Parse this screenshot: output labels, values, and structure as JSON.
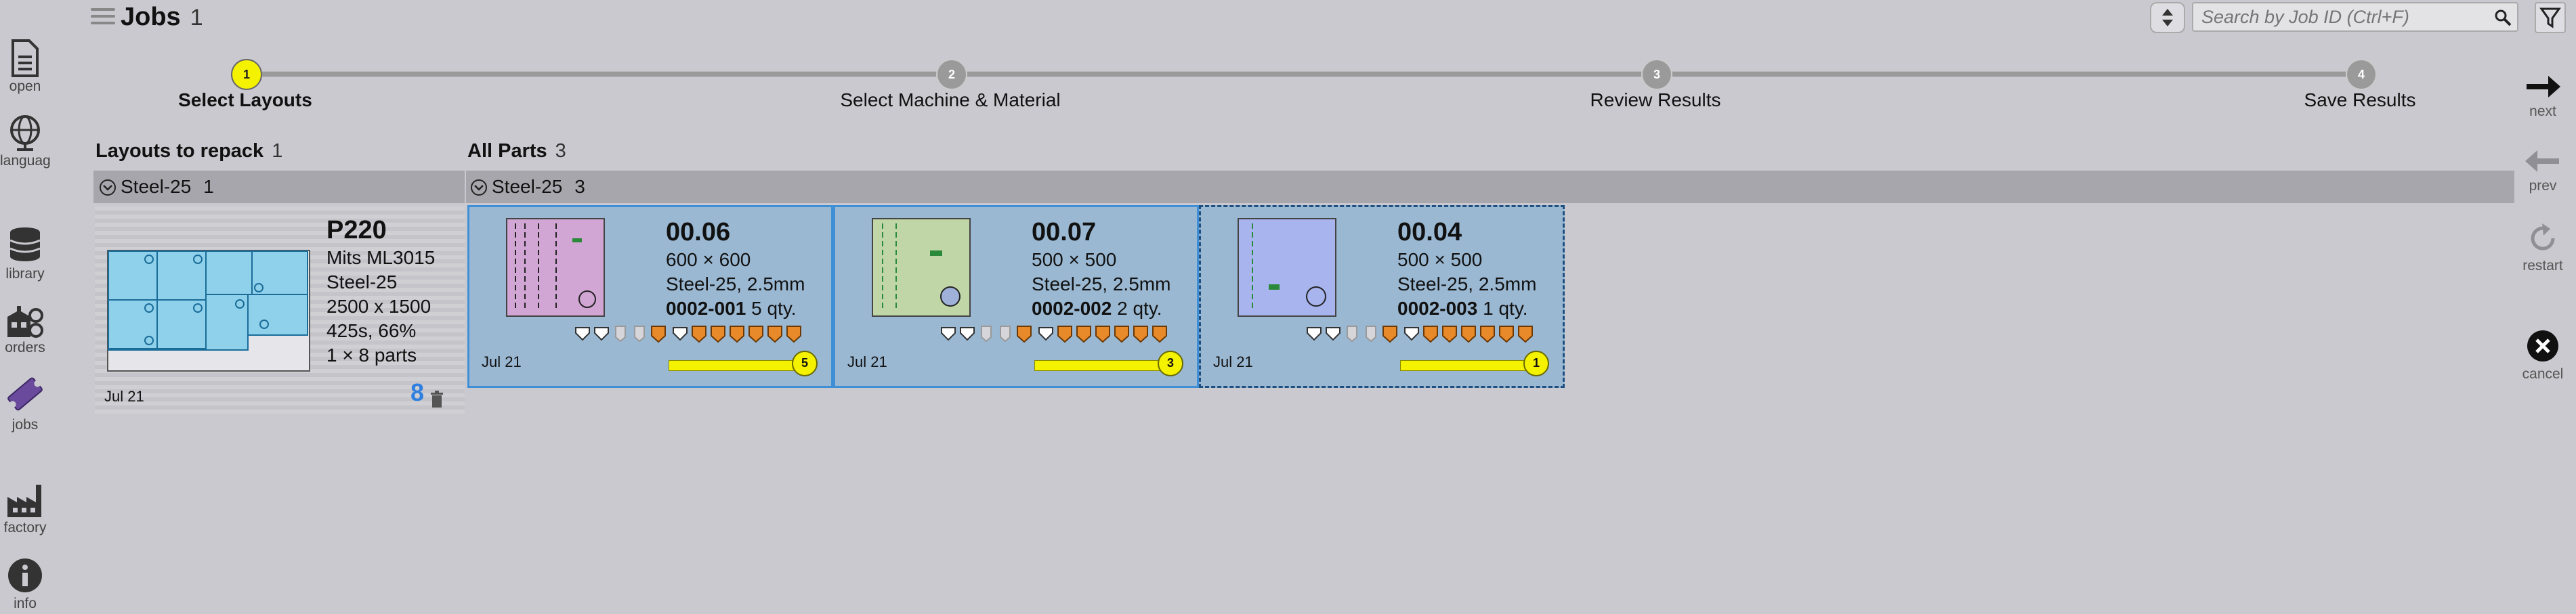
{
  "nav": {
    "items": [
      {
        "label": "open",
        "icon": "document-icon"
      },
      {
        "label": "language",
        "icon": "globe-icon"
      },
      {
        "label": "library",
        "icon": "database-icon"
      },
      {
        "label": "orders",
        "icon": "orders-icon"
      },
      {
        "label": "jobs",
        "icon": "ticket-icon"
      },
      {
        "label": "factory",
        "icon": "factory-icon"
      },
      {
        "label": "info",
        "icon": "info-icon"
      }
    ]
  },
  "header": {
    "title": "Jobs",
    "count": "1",
    "search_placeholder": "Search by Job ID (Ctrl+F)"
  },
  "steps": [
    {
      "number": "1",
      "label": "Select Layouts"
    },
    {
      "number": "2",
      "label": "Select Machine & Material"
    },
    {
      "number": "3",
      "label": "Review Results"
    },
    {
      "number": "4",
      "label": "Save Results"
    }
  ],
  "rail": {
    "next": "next",
    "prev": "prev",
    "restart": "restart",
    "cancel": "cancel"
  },
  "layouts": {
    "title": "Layouts to repack",
    "count": "1",
    "group": {
      "label": "Steel-25",
      "count": "1"
    },
    "card": {
      "name": "P220",
      "machine": "Mits ML3015",
      "material": "Steel-25",
      "size": "2500 x 1500",
      "time_util": "425s, 66%",
      "parts": "1 × 8 parts",
      "date": "Jul 21",
      "part_count": "8"
    }
  },
  "parts": {
    "title": "All Parts",
    "count": "3",
    "group": {
      "label": "Steel-25",
      "count": "3"
    },
    "cards": [
      {
        "name": "00.06",
        "dims": "600 × 600",
        "material": "Steel-25, 2.5mm",
        "part_no": "0002-001",
        "qty": "5 qty.",
        "date": "Jul 21",
        "progress_label": "5",
        "thumb_color": "#d2a6d4"
      },
      {
        "name": "00.07",
        "dims": "500 × 500",
        "material": "Steel-25, 2.5mm",
        "part_no": "0002-002",
        "qty": "2 qty.",
        "date": "Jul 21",
        "progress_label": "3",
        "thumb_color": "#c1d6a7"
      },
      {
        "name": "00.04",
        "dims": "500 × 500",
        "material": "Steel-25, 2.5mm",
        "part_no": "0002-003",
        "qty": "1 qty.",
        "date": "Jul 21",
        "progress_label": "1",
        "thumb_color": "#a8b4ee"
      }
    ]
  },
  "colors": {
    "accent": "#3f8fd6",
    "step_active": "#f5f200",
    "step_inactive": "#9a9a9a",
    "tool_orange": "#e88a2a",
    "count_blue": "#2e7fe0"
  }
}
